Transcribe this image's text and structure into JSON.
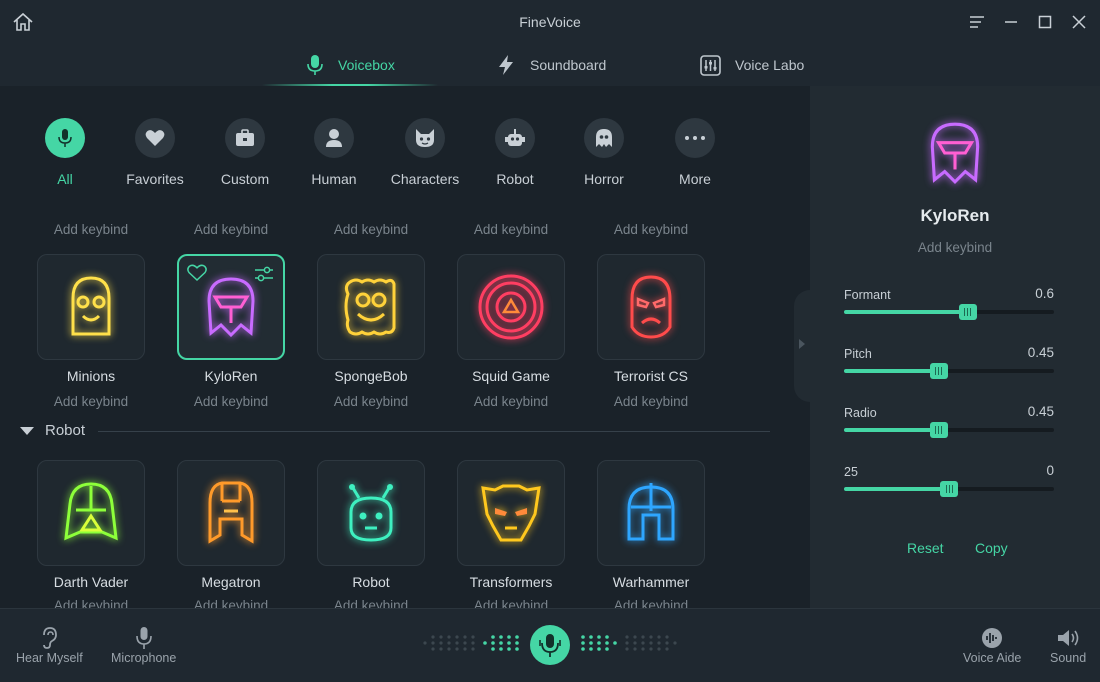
{
  "app": {
    "title": "FineVoice"
  },
  "main_tabs": [
    {
      "label": "Voicebox",
      "icon": "microphone-icon",
      "active": true
    },
    {
      "label": "Soundboard",
      "icon": "lightning-icon",
      "active": false
    },
    {
      "label": "Voice Labo",
      "icon": "sliders-icon",
      "active": false
    }
  ],
  "categories": [
    {
      "label": "All",
      "icon": "microphone-icon",
      "active": true
    },
    {
      "label": "Favorites",
      "icon": "heart-icon"
    },
    {
      "label": "Custom",
      "icon": "briefcase-icon"
    },
    {
      "label": "Human",
      "icon": "person-icon"
    },
    {
      "label": "Characters",
      "icon": "cat-face-icon"
    },
    {
      "label": "Robot",
      "icon": "robot-icon"
    },
    {
      "label": "Horror",
      "icon": "ghost-icon"
    },
    {
      "label": "More",
      "icon": "more-dots-icon"
    }
  ],
  "keybind_label": "Add keybind",
  "voices_row1": [
    {
      "name": "Minions",
      "color": "#ffe04a",
      "icon": "minion-icon"
    },
    {
      "name": "KyloRen",
      "color": "#c86bff",
      "icon": "kylo-ren-icon",
      "selected": true
    },
    {
      "name": "SpongeBob",
      "color": "#ffd23a",
      "icon": "spongebob-icon"
    },
    {
      "name": "Squid Game",
      "color": "#ff3e62",
      "icon": "squid-game-icon"
    },
    {
      "name": "Terrorist CS",
      "color": "#ff4b4b",
      "icon": "terrorist-mask-icon"
    }
  ],
  "section": {
    "label": "Robot"
  },
  "voices_row2": [
    {
      "name": "Darth Vader",
      "color": "#8dff3a",
      "icon": "darth-vader-icon"
    },
    {
      "name": "Megatron",
      "color": "#ff9a2a",
      "icon": "megatron-icon"
    },
    {
      "name": "Robot",
      "color": "#3ef0c0",
      "icon": "robot-head-icon"
    },
    {
      "name": "Transformers",
      "color": "#ffc81e",
      "icon": "transformers-icon"
    },
    {
      "name": "Warhammer",
      "color": "#2ea6ff",
      "icon": "warhammer-helmet-icon"
    }
  ],
  "panel": {
    "name": "KyloRen",
    "keybind": "Add keybind",
    "sliders": [
      {
        "label": "Formant",
        "value": "0.6",
        "level": 0.59
      },
      {
        "label": "Pitch",
        "value": "0.45",
        "level": 0.45
      },
      {
        "label": "Radio",
        "value": "0.45",
        "level": 0.45
      },
      {
        "label": "25",
        "value": "0",
        "level": 0.5
      }
    ],
    "reset": "Reset",
    "copy": "Copy"
  },
  "bottom": {
    "hear_myself": "Hear Myself",
    "microphone": "Microphone",
    "voice_aide": "Voice Aide",
    "sound": "Sound"
  },
  "colors": {
    "accent": "#45d6a5",
    "background": "#1c242c"
  }
}
